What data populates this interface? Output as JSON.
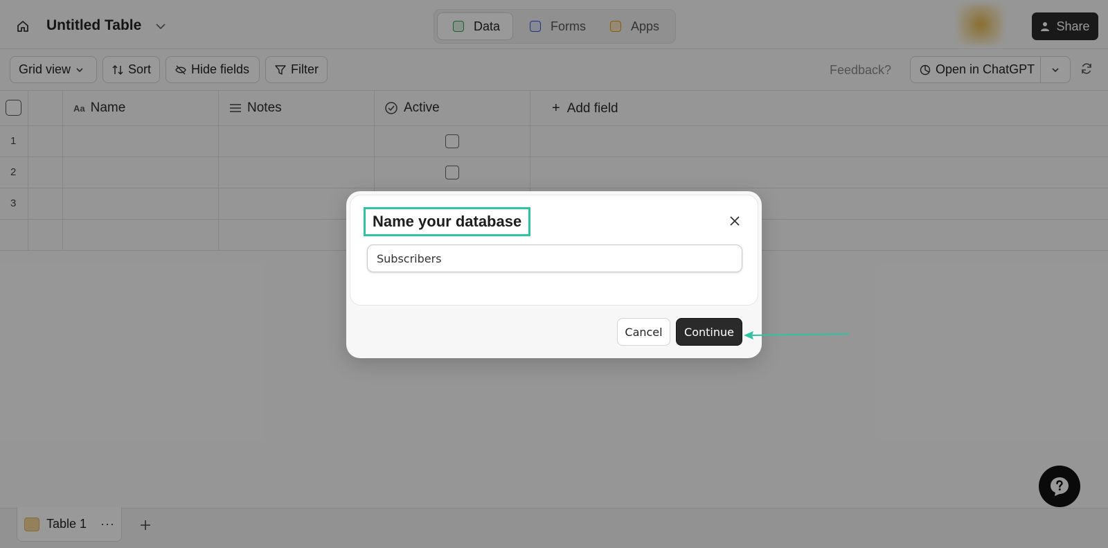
{
  "header": {
    "table_title": "Untitled Table",
    "modes": [
      {
        "label": "Data",
        "icon": "grid-icon",
        "color": "#2f9e5b",
        "active": true
      },
      {
        "label": "Forms",
        "icon": "form-icon",
        "color": "#3b55d9",
        "active": false
      },
      {
        "label": "Apps",
        "icon": "box-icon",
        "color": "#e39a1a",
        "active": false
      }
    ],
    "share_label": "Share"
  },
  "toolbar": {
    "grid_view_label": "Grid view",
    "sort_label": "Sort",
    "hide_fields_label": "Hide fields",
    "filter_label": "Filter",
    "feedback_label": "Feedback?",
    "open_chatgpt_label": "Open in ChatGPT"
  },
  "grid": {
    "columns": [
      {
        "label": "Name",
        "icon": "text-icon"
      },
      {
        "label": "Notes",
        "icon": "lines-icon"
      },
      {
        "label": "Active",
        "icon": "check-circle-icon"
      }
    ],
    "add_field_label": "Add field",
    "rows": [
      {
        "num": "1",
        "active_checkbox": true
      },
      {
        "num": "2",
        "active_checkbox": true
      },
      {
        "num": "3",
        "active_checkbox": false
      }
    ]
  },
  "footer": {
    "sheet_label": "Table 1",
    "sheet_more": "···"
  },
  "modal": {
    "title": "Name your database",
    "input_value": "Subscribers",
    "cancel_label": "Cancel",
    "continue_label": "Continue",
    "highlight_color": "#2ec4a2"
  }
}
